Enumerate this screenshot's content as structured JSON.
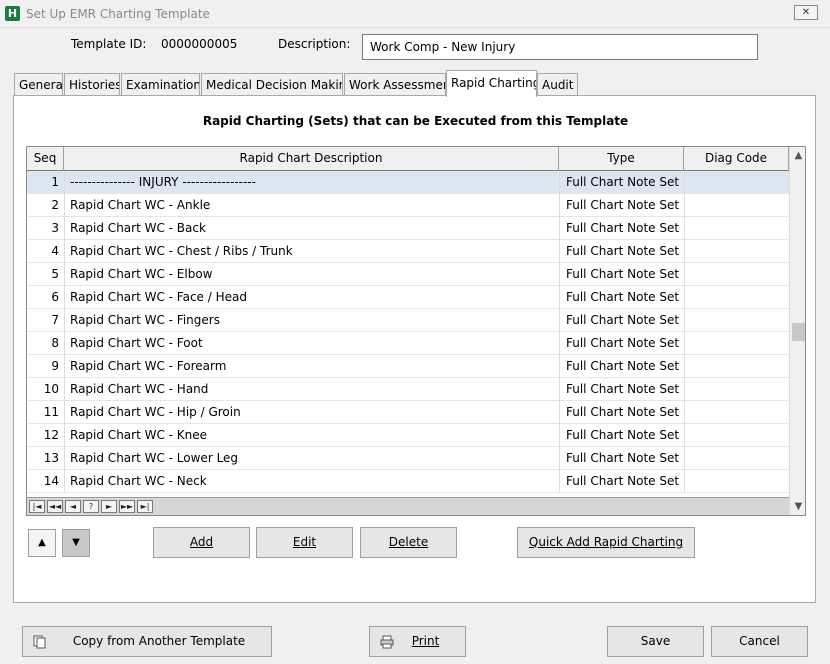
{
  "window": {
    "title": "Set Up EMR Charting Template",
    "close_glyph": "✕"
  },
  "header": {
    "template_id_label": "Template ID:",
    "template_id_value": "0000000005",
    "description_label": "Description:",
    "description_value": "Work Comp - New Injury"
  },
  "tabs": [
    {
      "label": "General"
    },
    {
      "label": "Histories"
    },
    {
      "label": "Examinations"
    },
    {
      "label": "Medical Decision Making"
    },
    {
      "label": "Work Assessment"
    },
    {
      "label": "Rapid Charting"
    },
    {
      "label": "Audit"
    }
  ],
  "panel": {
    "title": "Rapid Charting (Sets) that can be Executed from this Template"
  },
  "grid": {
    "columns": [
      "Seq",
      "Rapid Chart Description",
      "Type",
      "Diag Code"
    ],
    "rows": [
      {
        "seq": "1",
        "desc": "--------------- INJURY -----------------",
        "type": "Full Chart Note Set",
        "diag": ""
      },
      {
        "seq": "2",
        "desc": "Rapid Chart WC - Ankle",
        "type": "Full Chart Note Set",
        "diag": ""
      },
      {
        "seq": "3",
        "desc": "Rapid Chart WC - Back",
        "type": "Full Chart Note Set",
        "diag": ""
      },
      {
        "seq": "4",
        "desc": "Rapid Chart WC - Chest / Ribs / Trunk",
        "type": "Full Chart Note Set",
        "diag": ""
      },
      {
        "seq": "5",
        "desc": "Rapid Chart WC - Elbow",
        "type": "Full Chart Note Set",
        "diag": ""
      },
      {
        "seq": "6",
        "desc": "Rapid Chart WC - Face / Head",
        "type": "Full Chart Note Set",
        "diag": ""
      },
      {
        "seq": "7",
        "desc": "Rapid Chart WC - Fingers",
        "type": "Full Chart Note Set",
        "diag": ""
      },
      {
        "seq": "8",
        "desc": "Rapid Chart WC - Foot",
        "type": "Full Chart Note Set",
        "diag": ""
      },
      {
        "seq": "9",
        "desc": "Rapid Chart WC - Forearm",
        "type": "Full Chart Note Set",
        "diag": ""
      },
      {
        "seq": "10",
        "desc": "Rapid Chart WC - Hand",
        "type": "Full Chart Note Set",
        "diag": ""
      },
      {
        "seq": "11",
        "desc": "Rapid Chart WC - Hip / Groin",
        "type": "Full Chart Note Set",
        "diag": ""
      },
      {
        "seq": "12",
        "desc": "Rapid Chart WC - Knee",
        "type": "Full Chart Note Set",
        "diag": ""
      },
      {
        "seq": "13",
        "desc": "Rapid Chart WC - Lower Leg",
        "type": "Full Chart Note Set",
        "diag": ""
      },
      {
        "seq": "14",
        "desc": "Rapid Chart WC - Neck",
        "type": "Full Chart Note Set",
        "diag": ""
      }
    ],
    "selected_row": "1"
  },
  "navigator": {
    "first": "|◄",
    "prev_page": "◄◄",
    "prev": "◄",
    "help": "?",
    "next": "►",
    "next_page": "►►",
    "last": "►|"
  },
  "buttons": {
    "add": "Add",
    "edit": "Edit",
    "delete": "Delete",
    "quick_add": "Quick Add Rapid Charting",
    "copy": "Copy from Another Template",
    "print": "Print",
    "save": "Save",
    "cancel": "Cancel"
  },
  "colors": {
    "selected_row": "#dbe6f2",
    "app_icon": "#1c7a3e"
  }
}
